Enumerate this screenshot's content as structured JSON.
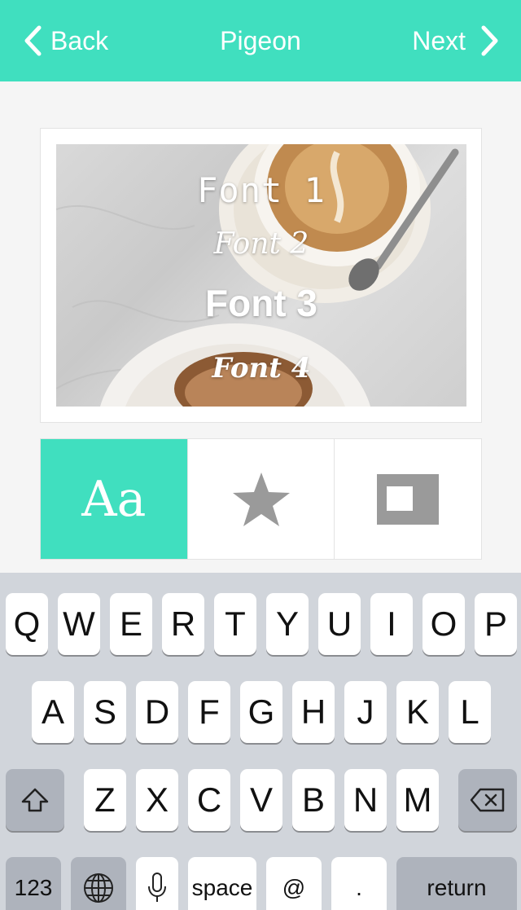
{
  "header": {
    "back_label": "Back",
    "title": "Pigeon",
    "next_label": "Next"
  },
  "preview": {
    "font_samples": [
      "Font 1",
      "Font 2",
      "Font 3",
      "Font 4"
    ]
  },
  "tools": {
    "text_tab_label": "Aa",
    "active_tab": "text"
  },
  "keyboard": {
    "row1": [
      "Q",
      "W",
      "E",
      "R",
      "T",
      "Y",
      "U",
      "I",
      "O",
      "P"
    ],
    "row2": [
      "A",
      "S",
      "D",
      "F",
      "G",
      "H",
      "J",
      "K",
      "L"
    ],
    "row3": [
      "Z",
      "X",
      "C",
      "V",
      "B",
      "N",
      "M"
    ],
    "numbers_label": "123",
    "space_label": "space",
    "at_label": "@",
    "period_label": ".",
    "return_label": "return"
  },
  "colors": {
    "accent": "#40dfbf",
    "icon_gray": "#9a9a9a"
  }
}
